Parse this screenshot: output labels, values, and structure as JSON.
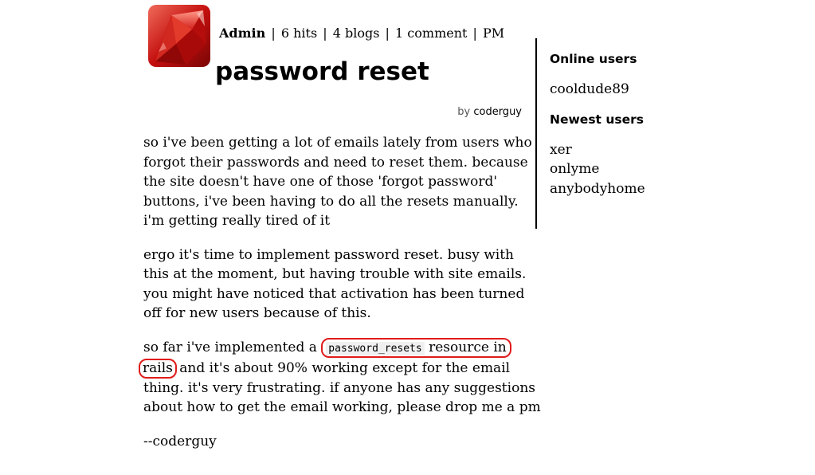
{
  "header": {
    "user": "Admin",
    "hits": "6 hits",
    "blogs": "4 blogs",
    "comments": "1 comment",
    "pm": "PM",
    "separator": "|",
    "logo_icon": "ruby-gem-icon"
  },
  "post": {
    "title": "password reset",
    "by_prefix": "by",
    "author": "coderguy",
    "p1": "so i've been getting a lot of emails lately from users who forgot their passwords and need to reset them. because the site doesn't have one of those 'forgot password' buttons, i've been having to do all the resets manually. i'm getting really tired of it",
    "p2": "ergo it's time to implement password reset. busy with this at the moment, but having trouble with site emails. you might have noticed that activation has been turned off for new users because of this.",
    "p3_before": "so far i've implemented a ",
    "p3_code": "password_resets",
    "p3_mid1": " resource in",
    "p3_mid2": "rails",
    "p3_after": " and it's about 90% working except for the email thing. it's very frustrating. if anyone has any suggestions about how to get the email working, please drop me a pm",
    "signoff": "--coderguy"
  },
  "sidebar": {
    "online_title": "Online users",
    "online_users": [
      "cooldude89"
    ],
    "newest_title": "Newest users",
    "newest_users": [
      "xer",
      "onlyme",
      "anybodyhome"
    ]
  },
  "colors": {
    "highlight": "#e01b1b",
    "ruby_red": "#c4100f"
  }
}
